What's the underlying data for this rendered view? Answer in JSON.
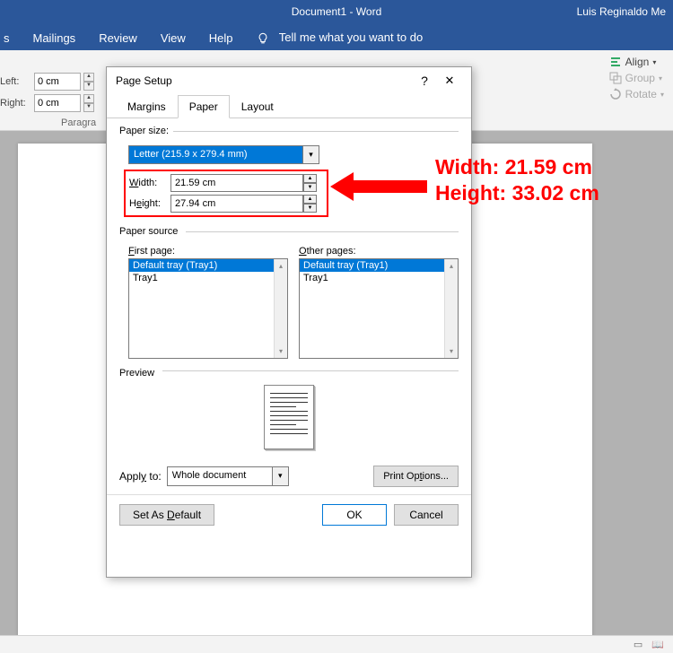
{
  "titlebar": {
    "doc": "Document1  -  Word",
    "user": "Luis Reginaldo Me"
  },
  "ribbon_tabs": {
    "t0": "s",
    "t1": "Mailings",
    "t2": "Review",
    "t3": "View",
    "t4": "Help",
    "tell": "Tell me what you want to do"
  },
  "indent": {
    "left_label": "Left:",
    "right_label": "Right:",
    "left_val": "0 cm",
    "right_val": "0 cm",
    "group": "Paragra"
  },
  "arrange": {
    "align": "Align",
    "group": "Group",
    "rotate": "Rotate"
  },
  "dialog": {
    "title": "Page Setup",
    "tabs": {
      "margins": "Margins",
      "paper": "Paper",
      "layout": "Layout"
    },
    "paper_size_label": "Paper size:",
    "paper_size_value": "Letter (215.9 x 279.4 mm)",
    "width_label": "Width:",
    "width_value": "21.59 cm",
    "height_label": "Height:",
    "height_value": "27.94 cm",
    "source_label": "Paper source",
    "first_page": "First page:",
    "other_pages": "Other pages:",
    "tray_default": "Default tray (Tray1)",
    "tray1": "Tray1",
    "preview": "Preview",
    "apply_to": "Apply to:",
    "apply_val": "Whole document",
    "print_options": "Print Options...",
    "set_default": "Set As Default",
    "ok": "OK",
    "cancel": "Cancel"
  },
  "annotation": {
    "line1": "Width: 21.59 cm",
    "line2": "Height: 33.02 cm"
  }
}
